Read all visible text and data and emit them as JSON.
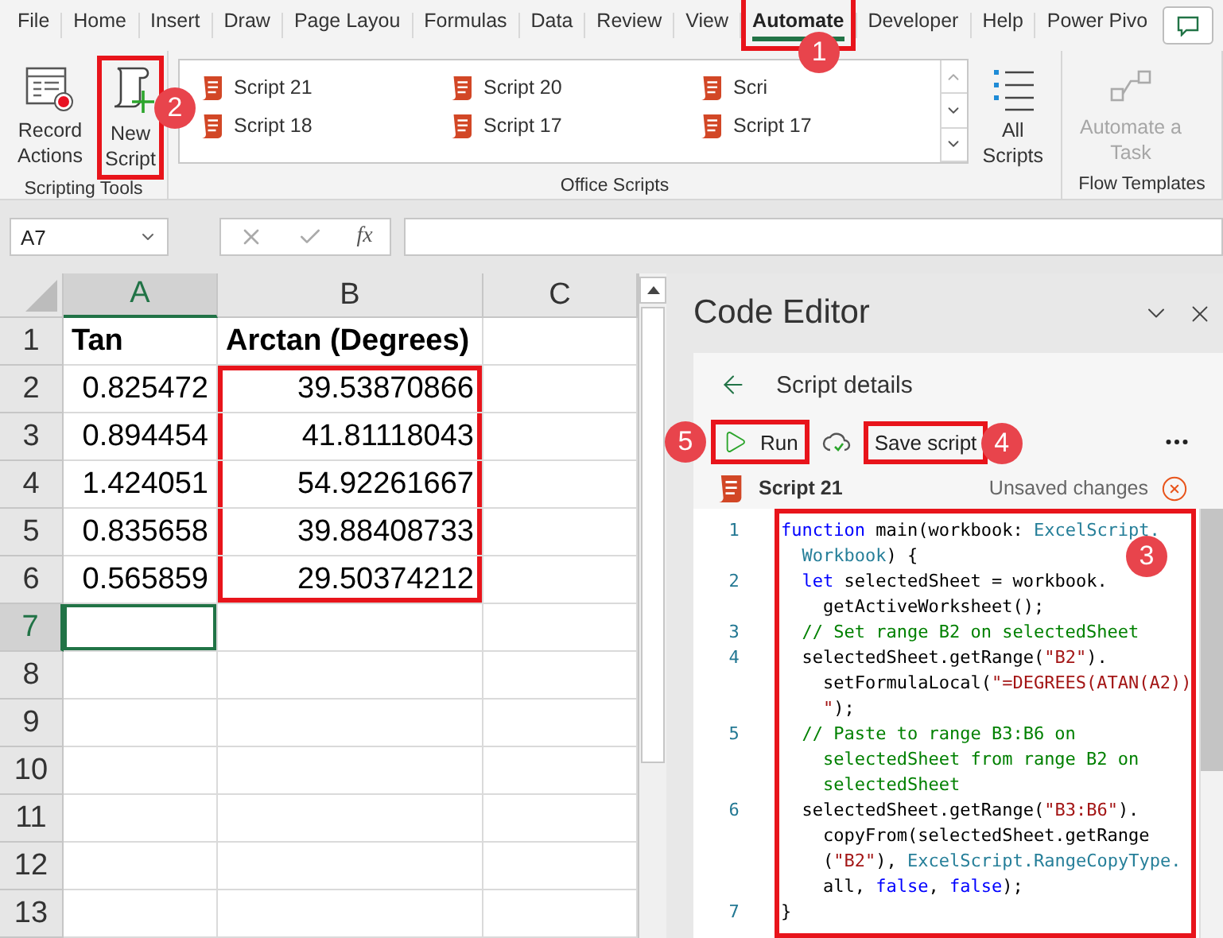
{
  "ribbon_tabs": [
    {
      "label": "File",
      "selected": false,
      "highlighted": false
    },
    {
      "label": "Home",
      "selected": false,
      "highlighted": false
    },
    {
      "label": "Insert",
      "selected": false,
      "highlighted": false
    },
    {
      "label": "Draw",
      "selected": false,
      "highlighted": false
    },
    {
      "label": "Page Layou",
      "selected": false,
      "highlighted": false
    },
    {
      "label": "Formulas",
      "selected": false,
      "highlighted": false
    },
    {
      "label": "Data",
      "selected": false,
      "highlighted": false
    },
    {
      "label": "Review",
      "selected": false,
      "highlighted": false
    },
    {
      "label": "View",
      "selected": false,
      "highlighted": false
    },
    {
      "label": "Automate",
      "selected": true,
      "highlighted": true,
      "callout": "1"
    },
    {
      "label": "Developer",
      "selected": false,
      "highlighted": false
    },
    {
      "label": "Help",
      "selected": false,
      "highlighted": false
    },
    {
      "label": "Power Pivo",
      "selected": false,
      "highlighted": false
    }
  ],
  "scripting_tools": {
    "label": "Scripting Tools",
    "record_button": {
      "label": "Record Actions",
      "highlighted": false
    },
    "new_script_button": {
      "label": "New Script",
      "highlighted": true,
      "callout": "2"
    }
  },
  "office_scripts": {
    "label": "Office Scripts",
    "scripts": [
      {
        "name": "Script 21"
      },
      {
        "name": "Script 20"
      },
      {
        "name": "Scri"
      },
      {
        "name": "Script 18"
      },
      {
        "name": "Script 17"
      },
      {
        "name": "Script 17"
      }
    ],
    "all_scripts_button": {
      "label": "All Scripts"
    }
  },
  "flow_templates": {
    "label": "Flow Templates",
    "automate_button": {
      "label": "Automate a Task",
      "disabled": true
    }
  },
  "formula_bar": {
    "name_box": "A7",
    "function_label": "fx"
  },
  "sheet": {
    "columns": [
      {
        "label": "A",
        "selected": true
      },
      {
        "label": "B",
        "selected": false
      },
      {
        "label": "C",
        "selected": false
      }
    ],
    "rows": [
      {
        "number": "1",
        "selected": false,
        "cells": [
          {
            "kind": "header",
            "text": "Tan",
            "selected": false,
            "highlighted": false
          },
          {
            "kind": "header",
            "text": "Arctan (Degrees)",
            "selected": false,
            "highlighted": false
          },
          {
            "selected": false,
            "highlighted": false
          }
        ]
      },
      {
        "number": "2",
        "selected": false,
        "cells": [
          {
            "kind": "number",
            "text": "0.825472",
            "selected": false,
            "highlighted": false
          },
          {
            "kind": "number",
            "text": "39.53870866",
            "selected": false,
            "highlighted": true
          },
          {
            "selected": false,
            "highlighted": false
          }
        ]
      },
      {
        "number": "3",
        "selected": false,
        "cells": [
          {
            "kind": "number",
            "text": "0.894454",
            "selected": false,
            "highlighted": false
          },
          {
            "kind": "number",
            "text": "41.81118043",
            "selected": false,
            "highlighted": true
          },
          {
            "selected": false,
            "highlighted": false
          }
        ]
      },
      {
        "number": "4",
        "selected": false,
        "cells": [
          {
            "kind": "number",
            "text": "1.424051",
            "selected": false,
            "highlighted": false
          },
          {
            "kind": "number",
            "text": "54.92261667",
            "selected": false,
            "highlighted": true
          },
          {
            "selected": false,
            "highlighted": false
          }
        ]
      },
      {
        "number": "5",
        "selected": false,
        "cells": [
          {
            "kind": "number",
            "text": "0.835658",
            "selected": false,
            "highlighted": false
          },
          {
            "kind": "number",
            "text": "39.88408733",
            "selected": false,
            "highlighted": true
          },
          {
            "selected": false,
            "highlighted": false
          }
        ]
      },
      {
        "number": "6",
        "selected": false,
        "cells": [
          {
            "kind": "number",
            "text": "0.565859",
            "selected": false,
            "highlighted": false
          },
          {
            "kind": "number",
            "text": "29.50374212",
            "selected": false,
            "highlighted": true
          },
          {
            "selected": false,
            "highlighted": false
          }
        ]
      },
      {
        "number": "7",
        "selected": true,
        "cells": [
          {
            "selected": true,
            "highlighted": false
          },
          {
            "selected": false,
            "highlighted": false
          },
          {
            "selected": false,
            "highlighted": false
          }
        ]
      },
      {
        "number": "8",
        "selected": false,
        "cells": [
          {
            "selected": false,
            "highlighted": false
          },
          {
            "selected": false,
            "highlighted": false
          },
          {
            "selected": false,
            "highlighted": false
          }
        ]
      },
      {
        "number": "9",
        "selected": false,
        "cells": [
          {
            "selected": false,
            "highlighted": false
          },
          {
            "selected": false,
            "highlighted": false
          },
          {
            "selected": false,
            "highlighted": false
          }
        ]
      },
      {
        "number": "10",
        "selected": false,
        "cells": [
          {
            "selected": false,
            "highlighted": false
          },
          {
            "selected": false,
            "highlighted": false
          },
          {
            "selected": false,
            "highlighted": false
          }
        ]
      },
      {
        "number": "11",
        "selected": false,
        "cells": [
          {
            "selected": false,
            "highlighted": false
          },
          {
            "selected": false,
            "highlighted": false
          },
          {
            "selected": false,
            "highlighted": false
          }
        ]
      },
      {
        "number": "12",
        "selected": false,
        "cells": [
          {
            "selected": false,
            "highlighted": false
          },
          {
            "selected": false,
            "highlighted": false
          },
          {
            "selected": false,
            "highlighted": false
          }
        ]
      },
      {
        "number": "13",
        "selected": false,
        "cells": [
          {
            "selected": false,
            "highlighted": false
          },
          {
            "selected": false,
            "highlighted": false
          },
          {
            "selected": false,
            "highlighted": false
          }
        ]
      }
    ]
  },
  "code_editor": {
    "title": "Code Editor",
    "back_title": "Script details",
    "run_button": {
      "label": "Run",
      "highlighted": true,
      "callout": "5"
    },
    "save_button": {
      "label": "Save script",
      "highlighted": true,
      "callout": "4"
    },
    "script_name": "Script 21",
    "status": "Unsaved changes",
    "code": {
      "highlighted": true,
      "callout": "3",
      "lines": [
        {
          "number": "1",
          "rows": [
            {
              "tokens": [
                {
                  "text": "function",
                  "color": "#0000ff"
                },
                {
                  "text": " main(workbook: ",
                  "color": "#000000"
                },
                {
                  "text": "ExcelScript.",
                  "color": "#267f99"
                }
              ]
            },
            {
              "tokens": [
                {
                  "text": "  Workbook",
                  "color": "#267f99"
                },
                {
                  "text": ") {",
                  "color": "#000000"
                }
              ]
            }
          ]
        },
        {
          "number": "2",
          "rows": [
            {
              "tokens": [
                {
                  "text": "  let",
                  "color": "#0000ff"
                },
                {
                  "text": " selectedSheet = workbook.",
                  "color": "#000000"
                }
              ]
            },
            {
              "tokens": [
                {
                  "text": "    getActiveWorksheet();",
                  "color": "#000000"
                }
              ]
            }
          ]
        },
        {
          "number": "3",
          "rows": [
            {
              "tokens": [
                {
                  "text": "  // Set range B2 on selectedSheet",
                  "color": "#008000"
                }
              ]
            }
          ]
        },
        {
          "number": "4",
          "rows": [
            {
              "tokens": [
                {
                  "text": "  selectedSheet.getRange(",
                  "color": "#000000"
                },
                {
                  "text": "\"B2\"",
                  "color": "#a31515"
                },
                {
                  "text": ").",
                  "color": "#000000"
                }
              ]
            },
            {
              "tokens": [
                {
                  "text": "    setFormulaLocal(",
                  "color": "#000000"
                },
                {
                  "text": "\"=DEGREES(ATAN(A2))",
                  "color": "#a31515"
                }
              ]
            },
            {
              "tokens": [
                {
                  "text": "    \"",
                  "color": "#a31515"
                },
                {
                  "text": ");",
                  "color": "#000000"
                }
              ]
            }
          ]
        },
        {
          "number": "5",
          "rows": [
            {
              "tokens": [
                {
                  "text": "  // Paste to range B3:B6 on",
                  "color": "#008000"
                }
              ]
            },
            {
              "tokens": [
                {
                  "text": "    selectedSheet from range B2 on",
                  "color": "#008000"
                }
              ]
            },
            {
              "tokens": [
                {
                  "text": "    selectedSheet",
                  "color": "#008000"
                }
              ]
            }
          ]
        },
        {
          "number": "6",
          "rows": [
            {
              "tokens": [
                {
                  "text": "  selectedSheet.getRange(",
                  "color": "#000000"
                },
                {
                  "text": "\"B3:B6\"",
                  "color": "#a31515"
                },
                {
                  "text": ").",
                  "color": "#000000"
                }
              ]
            },
            {
              "tokens": [
                {
                  "text": "    copyFrom(selectedSheet.getRange",
                  "color": "#000000"
                }
              ]
            },
            {
              "tokens": [
                {
                  "text": "    (",
                  "color": "#000000"
                },
                {
                  "text": "\"B2\"",
                  "color": "#a31515"
                },
                {
                  "text": "), ",
                  "color": "#000000"
                },
                {
                  "text": "ExcelScript.RangeCopyType.",
                  "color": "#267f99"
                }
              ]
            },
            {
              "tokens": [
                {
                  "text": "    all, ",
                  "color": "#000000"
                },
                {
                  "text": "false",
                  "color": "#0000ff"
                },
                {
                  "text": ", ",
                  "color": "#000000"
                },
                {
                  "text": "false",
                  "color": "#0000ff"
                },
                {
                  "text": ");",
                  "color": "#000000"
                }
              ]
            }
          ]
        },
        {
          "number": "7",
          "rows": [
            {
              "tokens": [
                {
                  "text": "}",
                  "color": "#000000"
                }
              ]
            }
          ]
        }
      ]
    }
  }
}
